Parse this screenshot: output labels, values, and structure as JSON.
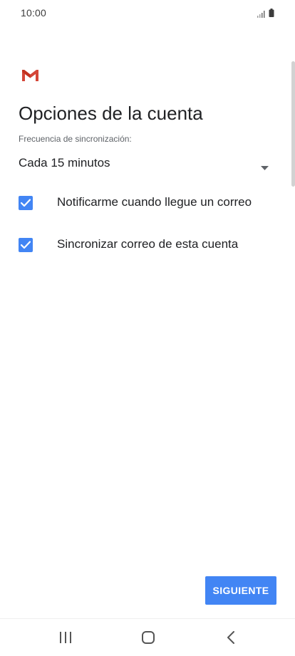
{
  "status_bar": {
    "time": "10:00",
    "signal_icon": "signal-icon",
    "battery_icon": "battery-icon"
  },
  "app": {
    "logo_icon": "gmail-logo-icon",
    "brand_color": "#d44638"
  },
  "page": {
    "title": "Opciones de la cuenta"
  },
  "sync": {
    "label": "Frecuencia de sincronización:",
    "selected_value": "Cada 15 minutos"
  },
  "options": [
    {
      "label": "Notificarme cuando llegue un correo",
      "checked": true
    },
    {
      "label": "Sincronizar correo de esta cuenta",
      "checked": true
    }
  ],
  "footer": {
    "next_label": "SIGUIENTE"
  },
  "nav_bar": {
    "recents_icon": "recents-icon",
    "home_icon": "home-icon",
    "back_icon": "back-icon"
  },
  "colors": {
    "accent": "#4285f4",
    "text_primary": "#202124",
    "text_secondary": "#5f6368"
  }
}
